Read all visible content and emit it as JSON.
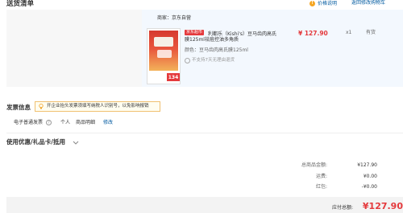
{
  "header": {
    "title": "送货清单",
    "price_note": "价格说明",
    "back_to_cart": "返回修改购物车"
  },
  "order": {
    "shop": "商家：京东自营",
    "thumb_badge": "134",
    "tag": "京东超市",
    "product_name_line1": "利都乐（Kishi's）豆马齿肉高氏",
    "product_name_line2": "膜125ml祛痘控油多角质",
    "spec": "颜色：豆马齿肉高氏膜125ml",
    "no_return": "不支持7天无理由退货",
    "price": "¥ 127.90",
    "qty": "x1",
    "stock": "有货"
  },
  "invoice": {
    "title": "发票信息",
    "tip": "开企业抬头发票须填写纳税人识别号，以免影响报销",
    "type": "电子普通发票",
    "person": "个人",
    "detail": "商品明细",
    "edit": "修改"
  },
  "coupon": {
    "title": "使用优惠/礼品卡/抵用"
  },
  "summary": {
    "total_label": "总商品金额:",
    "total_value": "¥127.90",
    "shipping_label": "运费:",
    "shipping_value": "¥0.00",
    "discount_label": "红包:",
    "discount_value": "-¥0.00",
    "pay_label": "应付总额:",
    "pay_value": "¥127.90"
  },
  "colors": {
    "accent_red": "#e4393c",
    "link_blue": "#005aa0"
  }
}
